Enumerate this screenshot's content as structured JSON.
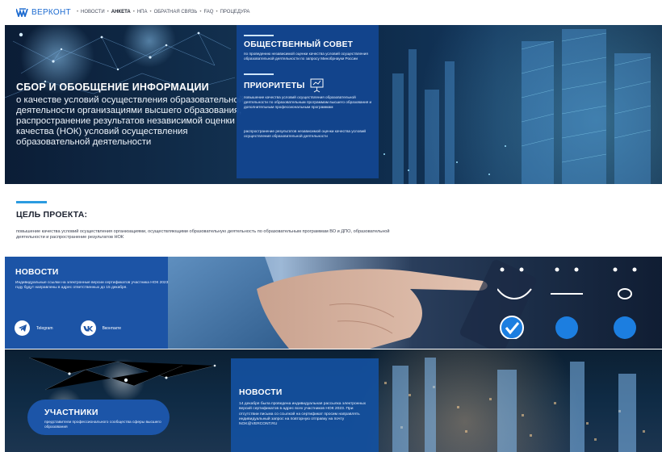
{
  "nav": {
    "brand": "ВЕРКОНТ",
    "items": [
      {
        "label": "НОВОСТИ",
        "active": false
      },
      {
        "label": "АНКЕТА",
        "active": true
      },
      {
        "label": "НПА",
        "active": false
      },
      {
        "label": "ОБРАТНАЯ СВЯЗЬ",
        "active": false
      },
      {
        "label": "FAQ",
        "active": false
      },
      {
        "label": "ПРОЦЕДУРА",
        "active": false
      }
    ],
    "separator": "•"
  },
  "hero": {
    "title": "СБОР И ОБОБЩЕНИЕ ИНФОРМАЦИИ",
    "description": "о качестве условий осуществления образовательной деятельности организациями высшего образования, распространение результатов независимой оценки качества (НОК) условий осуществления образовательной деятельности",
    "panel": {
      "council_title": "ОБЩЕСТВЕННЫЙ СОВЕТ",
      "council_text": "по проведению независимой оценки качества условий осуществления образовательной деятельности по запросу Минобрнауки России",
      "priorities_title": "ПРИОРИТЕТЫ",
      "priorities_text": "повышение качества условий осуществления образовательной деятельности по образовательным программам высшего образования и дополнительным профессиональным программам",
      "bottom_text": "распространение результатов независимой оценки качества условий осуществления образовательной деятельности"
    }
  },
  "goal": {
    "title": "ЦЕЛЬ ПРОЕКТА:",
    "text": "повышение качества условий осуществления организациями, осуществляющими образовательную деятельность по образовательным программам ВО и ДПО, образовательной деятельности и распространение результатов НОК"
  },
  "news_band": {
    "title": "НОВОСТИ",
    "text": "Индивидуальные ссылки на электронные версии сертификатов участника НОК 2023 году будут направлены в адрес ответственных до 15 декабря.",
    "socials": [
      {
        "label": "Telegram",
        "icon": "telegram-icon"
      },
      {
        "label": "Вконтакте",
        "icon": "vk-icon"
      }
    ]
  },
  "bottom": {
    "members_title": "УЧАСТНИКИ",
    "members_text": "представители профессионального сообщества сферы высшего образования",
    "news_title": "НОВОСТИ",
    "news_text": "14 декабря была проведена индивидуальная рассылка электронных версий сертификатов в адрес всех участников НОК 2023. При отсутствии письма со ссылкой на сертификат просим направлять индивидуальный запрос на повторную отправку на почту NOK@VERCONT.RU"
  },
  "colors": {
    "brand_blue": "#1d6bd0",
    "panel_blue": "#1c54a6",
    "accent_line": "#2b9be0"
  }
}
